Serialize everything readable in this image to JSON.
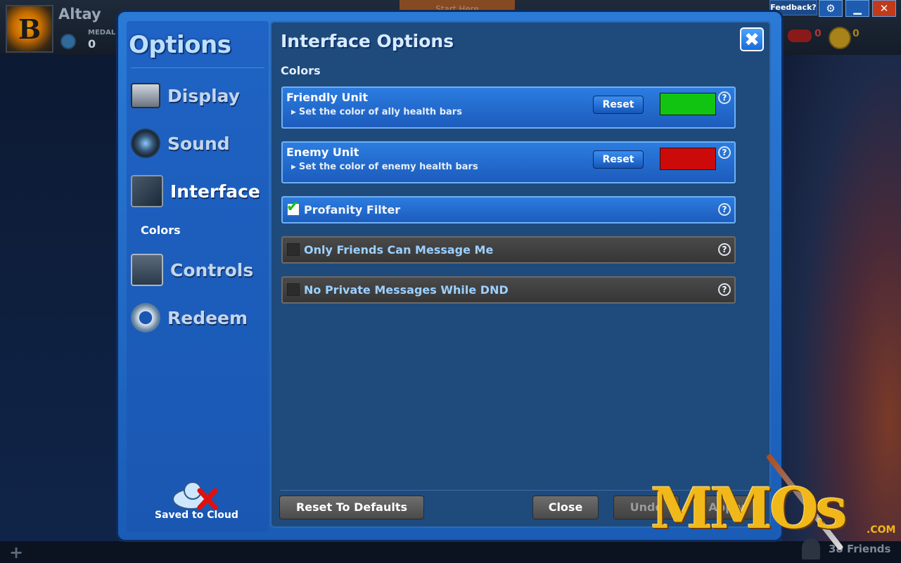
{
  "player": {
    "name": "Altay",
    "medals_label": "MEDALS",
    "medals_value": "0"
  },
  "topbar": {
    "start_here": "Start Here",
    "resource1": "0",
    "resource2": "0",
    "feedback": "Feedback?"
  },
  "window_buttons": {
    "settings": "⚙",
    "minimize": "▁",
    "close": "✕"
  },
  "sidebar": {
    "title": "Options",
    "items": [
      {
        "label": "Display"
      },
      {
        "label": "Sound"
      },
      {
        "label": "Interface"
      },
      {
        "label": "Controls"
      },
      {
        "label": "Redeem"
      }
    ],
    "sub_item": "Colors",
    "cloud_label": "Saved to Cloud"
  },
  "panel": {
    "title": "Interface Options",
    "section": "Colors",
    "close_symbol": "✖",
    "friendly": {
      "title": "Friendly Unit",
      "desc": "Set the color of ally health bars",
      "reset": "Reset",
      "color": "#12c412"
    },
    "enemy": {
      "title": "Enemy Unit",
      "desc": "Set the color of enemy health bars",
      "reset": "Reset",
      "color": "#cc0a0a"
    },
    "toggles": [
      {
        "label": "Profanity Filter",
        "checked": true
      },
      {
        "label": "Only Friends Can Message Me",
        "checked": false
      },
      {
        "label": "No Private Messages While DND",
        "checked": false
      }
    ],
    "help": "?"
  },
  "footer": {
    "reset_defaults": "Reset To Defaults",
    "close": "Close",
    "undo": "Undo",
    "apply": "Apply"
  },
  "bottombar": {
    "add": "+",
    "friends": "38 Friends"
  },
  "watermark": {
    "text": "MMOs",
    "suffix": ".COM"
  }
}
